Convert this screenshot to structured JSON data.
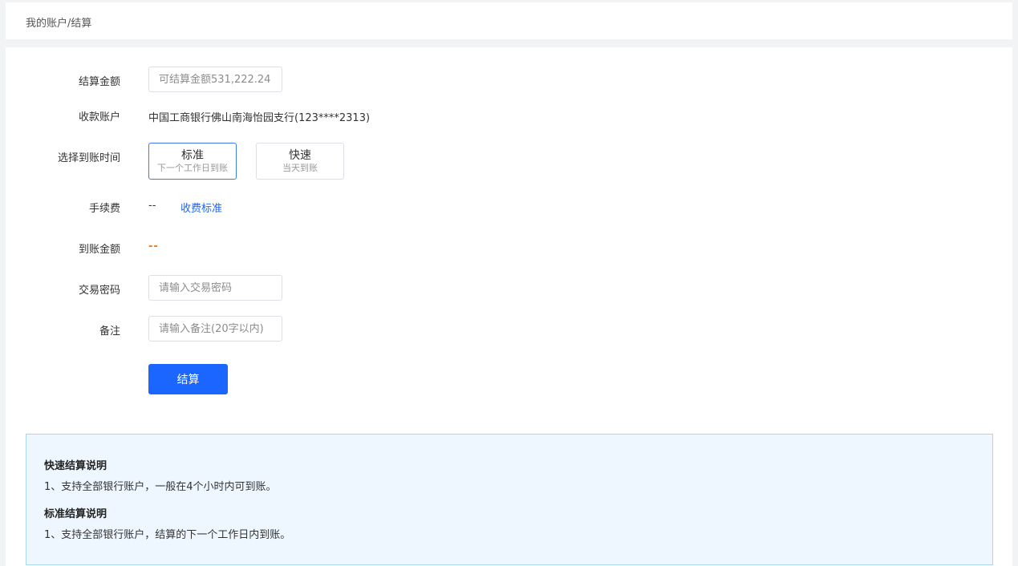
{
  "breadcrumb": "我的账户/结算",
  "form": {
    "amount": {
      "label": "结算金额",
      "placeholder": "可结算金额531,222.24"
    },
    "account": {
      "label": "收款账户",
      "value": "中国工商银行佛山南海怡园支行(123****2313)"
    },
    "arrival_time": {
      "label": "选择到账时间",
      "options": [
        {
          "title": "标准",
          "subtitle": "下一个工作日到账",
          "selected": true
        },
        {
          "title": "快速",
          "subtitle": "当天到账",
          "selected": false
        }
      ]
    },
    "fee": {
      "label": "手续费",
      "value": "--",
      "link": "收费标准"
    },
    "arrival_amount": {
      "label": "到账金额",
      "value": "--"
    },
    "password": {
      "label": "交易密码",
      "placeholder": "请输入交易密码"
    },
    "remark": {
      "label": "备注",
      "placeholder": "请输入备注(20字以内)"
    },
    "submit_label": "结算"
  },
  "info": {
    "fast_title": "快速结算说明",
    "fast_line": "1、支持全部银行账户，一般在4个小时内可到账。",
    "standard_title": "标准结算说明",
    "standard_line": "1、支持全部银行账户，结算的下一个工作日内到账。"
  },
  "colors": {
    "primary": "#1a66ff",
    "selected_border": "#3b7cf5",
    "amount_orange": "#f07b1d",
    "info_background": "#eef7ff",
    "info_border": "#a9d6f2"
  }
}
